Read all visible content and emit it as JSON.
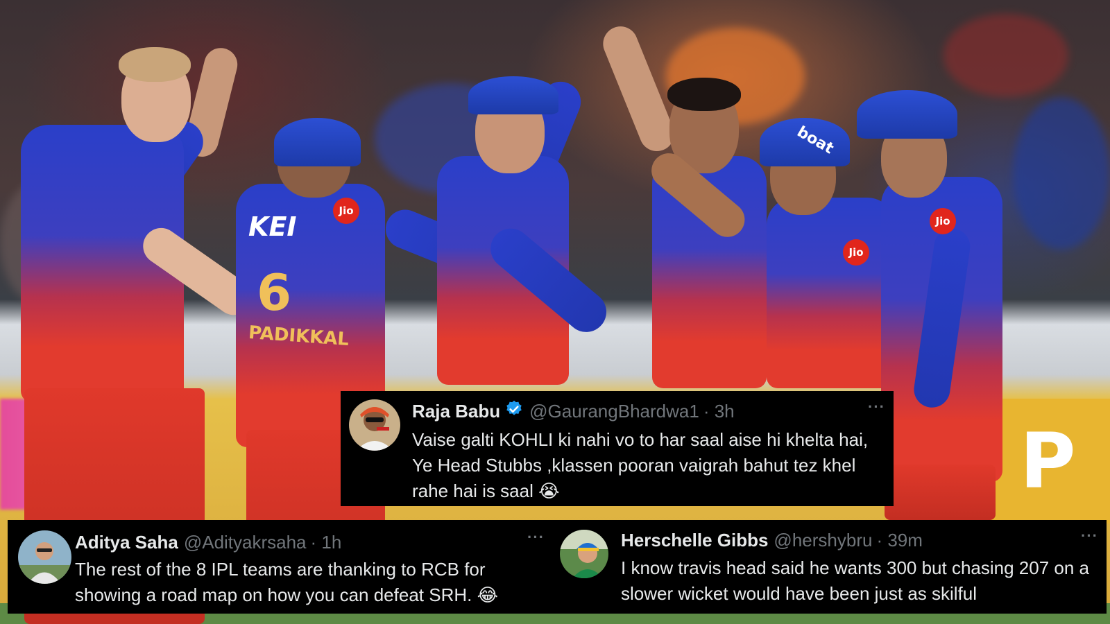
{
  "background": {
    "board_letter": "P"
  },
  "jerseys": {
    "kei": "KEI",
    "jio": "Jio",
    "boat": "boat",
    "number_six": "6",
    "name_padikkal": "PADIKKAL"
  },
  "tweets": [
    {
      "id": "main",
      "name": "Raja Babu",
      "verified": true,
      "handle": "@GaurangBhardwa1",
      "time": "· 3h",
      "more": "···",
      "text": "Vaise galti KOHLI ki nahi vo to har saal aise hi khelta hai, Ye Head Stubbs ,klassen pooran vaigrah bahut tez khel rahe hai is saal",
      "emoji": "😭"
    },
    {
      "id": "left",
      "name": "Aditya Saha",
      "verified": false,
      "handle": "@Adityakrsaha",
      "time": "· 1h",
      "more": "···",
      "text": "The rest of the 8 IPL teams are thanking to RCB for showing a road map on how you can defeat SRH.",
      "emoji": "😂"
    },
    {
      "id": "right",
      "name": "Herschelle Gibbs",
      "verified": false,
      "handle": "@hershybru",
      "time": "· 39m",
      "more": "···",
      "text": "I know travis head said he wants 300  but chasing 207 on a slower wicket would have been just as skilful",
      "emoji": ""
    }
  ],
  "colors": {
    "tweet_bg": "#000000",
    "tweet_text": "#e7e9ea",
    "tweet_muted": "#71767b",
    "verified_blue": "#1d9bf0",
    "rcb_red": "#e23b2e",
    "rcb_blue": "#2a3fc9"
  }
}
